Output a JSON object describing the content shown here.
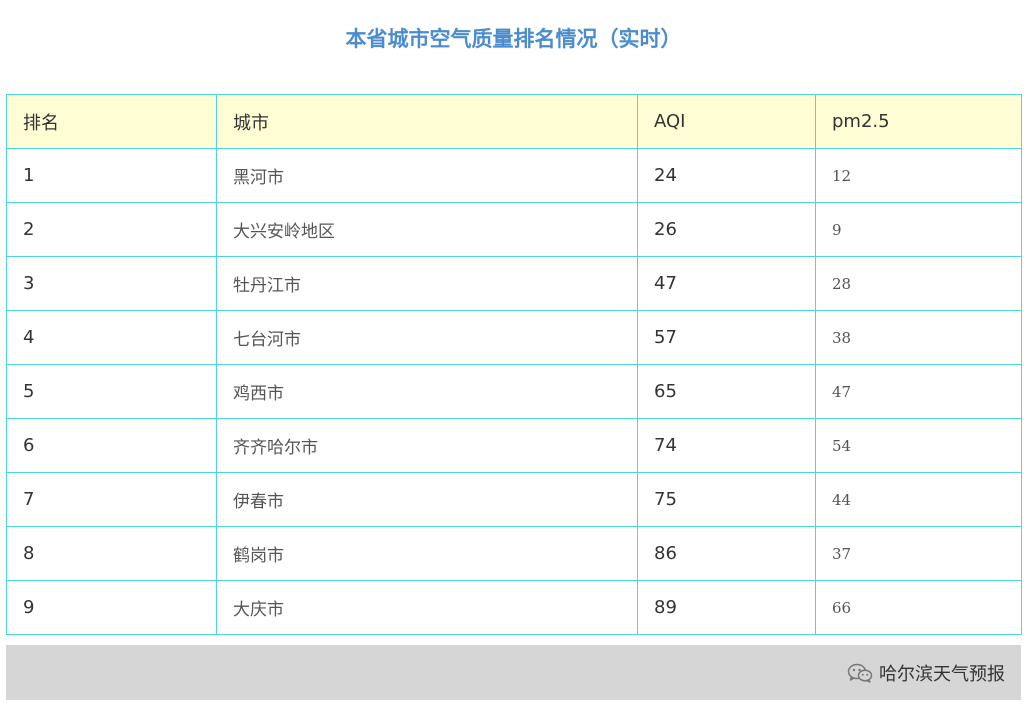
{
  "title": "本省城市空气质量排名情况（实时）",
  "table": {
    "headers": [
      "排名",
      "城市",
      "AQI",
      "pm2.5"
    ],
    "rows": [
      {
        "rank": "1",
        "city": "黑河市",
        "aqi": "24",
        "pm25": "12"
      },
      {
        "rank": "2",
        "city": "大兴安岭地区",
        "aqi": "26",
        "pm25": "9"
      },
      {
        "rank": "3",
        "city": "牡丹江市",
        "aqi": "47",
        "pm25": "28"
      },
      {
        "rank": "4",
        "city": "七台河市",
        "aqi": "57",
        "pm25": "38"
      },
      {
        "rank": "5",
        "city": "鸡西市",
        "aqi": "65",
        "pm25": "47"
      },
      {
        "rank": "6",
        "city": "齐齐哈尔市",
        "aqi": "74",
        "pm25": "54"
      },
      {
        "rank": "7",
        "city": "伊春市",
        "aqi": "75",
        "pm25": "44"
      },
      {
        "rank": "8",
        "city": "鹤岗市",
        "aqi": "86",
        "pm25": "37"
      },
      {
        "rank": "9",
        "city": "大庆市",
        "aqi": "89",
        "pm25": "66"
      }
    ]
  },
  "footer": {
    "source": "哈尔滨天气预报",
    "icon": "wechat-icon"
  },
  "colors": {
    "title": "#4a8ccf",
    "border": "#4fd6e4",
    "header_bg": "#fffdd4",
    "footer_bg": "#d6d6d6"
  }
}
